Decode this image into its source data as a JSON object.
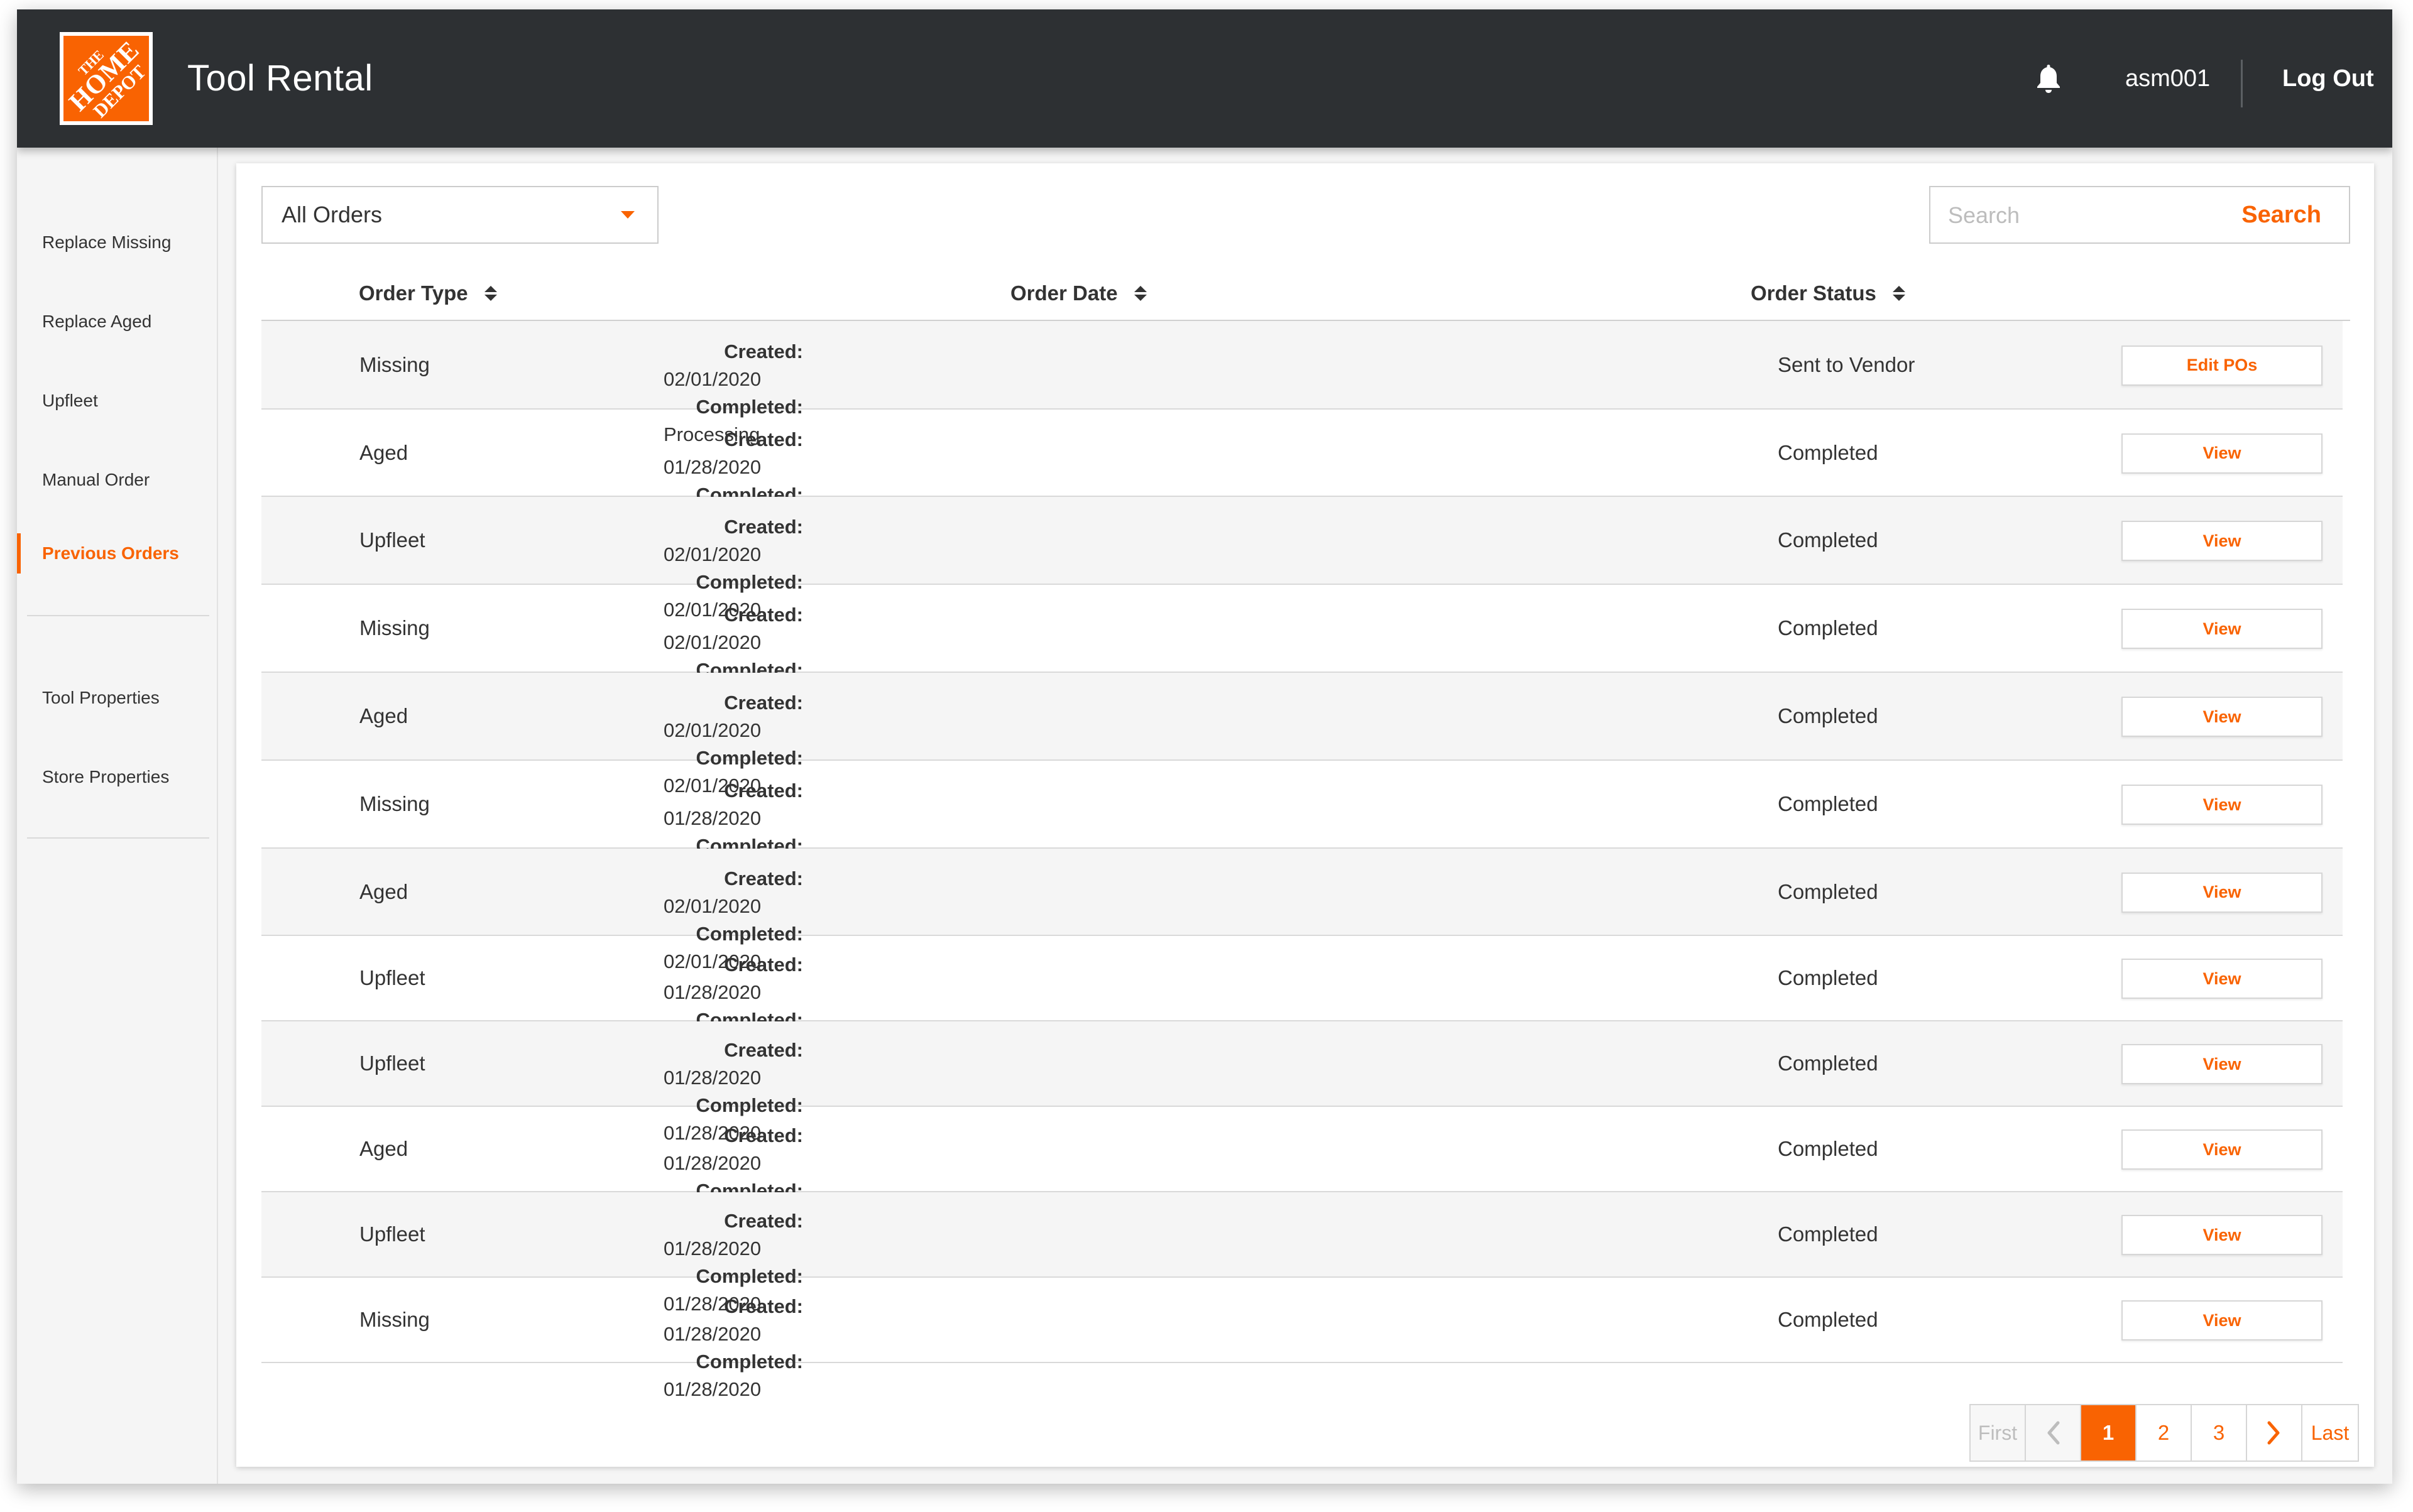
{
  "header": {
    "logo_lines": [
      "THE",
      "HOME",
      "DEPOT"
    ],
    "title": "Tool Rental",
    "bell_icon": "bell-icon",
    "username": "asm001",
    "logout_label": "Log Out"
  },
  "sidebar": {
    "items": [
      {
        "label": "Replace Missing",
        "active": false
      },
      {
        "label": "Replace Aged",
        "active": false
      },
      {
        "label": "Upfleet",
        "active": false
      },
      {
        "label": "Manual Order",
        "active": false
      },
      {
        "label": "Previous Orders",
        "active": true
      },
      {
        "label": "Tool Properties",
        "active": false
      },
      {
        "label": "Store Properties",
        "active": false
      }
    ]
  },
  "filter": {
    "selected": "All Orders",
    "icon": "caret-down-icon"
  },
  "search": {
    "placeholder": "Search",
    "value": "",
    "button_label": "Search"
  },
  "table": {
    "columns": [
      "Order Type",
      "Order Date",
      "Order Status"
    ],
    "created_label": "Created:",
    "completed_label": "Completed:",
    "rows": [
      {
        "type": "Missing",
        "created": "02/01/2020",
        "completed": "Processing",
        "status": "Sent to Vendor",
        "action": "Edit POs"
      },
      {
        "type": "Aged",
        "created": "01/28/2020",
        "completed": "01/28/2020",
        "status": "Completed",
        "action": "View"
      },
      {
        "type": "Upfleet",
        "created": "02/01/2020",
        "completed": "02/01/2020",
        "status": "Completed",
        "action": "View"
      },
      {
        "type": "Missing",
        "created": "02/01/2020",
        "completed": "02/01/2020",
        "status": "Completed",
        "action": "View"
      },
      {
        "type": "Aged",
        "created": "02/01/2020",
        "completed": "02/01/2020",
        "status": "Completed",
        "action": "View"
      },
      {
        "type": "Missing",
        "created": "01/28/2020",
        "completed": "01/28/2020",
        "status": "Completed",
        "action": "View"
      },
      {
        "type": "Aged",
        "created": "02/01/2020",
        "completed": "02/01/2020",
        "status": "Completed",
        "action": "View"
      },
      {
        "type": "Upfleet",
        "created": "01/28/2020",
        "completed": "01/28/2020",
        "status": "Completed",
        "action": "View"
      },
      {
        "type": "Upfleet",
        "created": "01/28/2020",
        "completed": "01/28/2020",
        "status": "Completed",
        "action": "View"
      },
      {
        "type": "Aged",
        "created": "01/28/2020",
        "completed": "01/28/2020",
        "status": "Completed",
        "action": "View"
      },
      {
        "type": "Upfleet",
        "created": "01/28/2020",
        "completed": "01/28/2020",
        "status": "Completed",
        "action": "View"
      },
      {
        "type": "Missing",
        "created": "01/28/2020",
        "completed": "01/28/2020",
        "status": "Completed",
        "action": "View"
      }
    ]
  },
  "pagination": {
    "first_label": "First",
    "last_label": "Last",
    "pages": [
      "1",
      "2",
      "3"
    ],
    "current_page": "1",
    "prev_icon": "chevron-left-icon",
    "next_icon": "chevron-right-icon"
  },
  "colors": {
    "brand_orange": "#f96302",
    "header_bg": "#2d3033",
    "sidebar_bg": "#f5f5f5",
    "row_shade": "#f5f5f5"
  }
}
